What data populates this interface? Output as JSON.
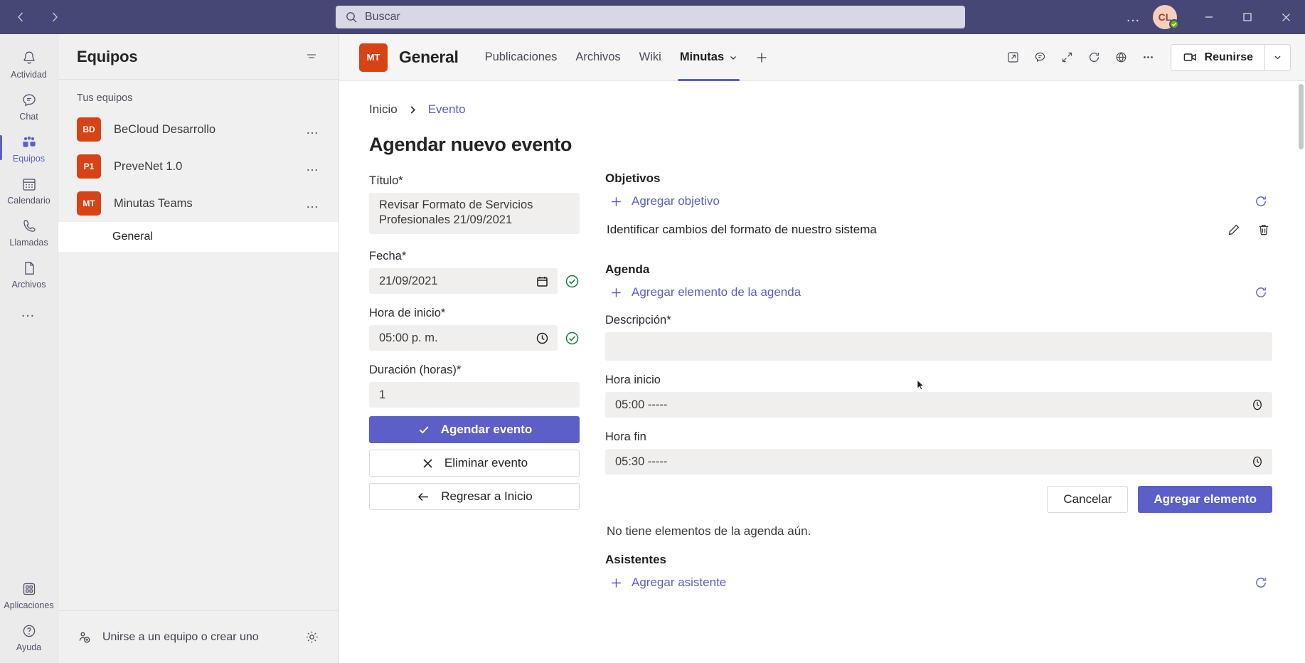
{
  "titlebar": {
    "back_label": "Atrás",
    "forward_label": "Adelante",
    "search_placeholder": "Buscar",
    "more_label": "…",
    "avatar_initials": "CL",
    "presence": "Disponible",
    "minimize_label": "Minimizar",
    "maximize_label": "Maximizar",
    "close_label": "Cerrar"
  },
  "rail": {
    "items": [
      {
        "label": "Actividad",
        "icon": "bell-icon",
        "active": false
      },
      {
        "label": "Chat",
        "icon": "chat-icon",
        "active": false
      },
      {
        "label": "Equipos",
        "icon": "teams-icon",
        "active": true
      },
      {
        "label": "Calendario",
        "icon": "calendar-icon",
        "active": false
      },
      {
        "label": "Llamadas",
        "icon": "phone-icon",
        "active": false
      },
      {
        "label": "Archivos",
        "icon": "file-icon",
        "active": false
      }
    ],
    "more_label": "…",
    "bottom": [
      {
        "label": "Aplicaciones",
        "icon": "apps-icon"
      },
      {
        "label": "Ayuda",
        "icon": "help-icon"
      }
    ]
  },
  "teams_panel": {
    "title": "Equipos",
    "filter_label": "Filtrar",
    "group_label": "Tus equipos",
    "teams": [
      {
        "initials": "BD",
        "name": "BeCloud Desarrollo",
        "more": "…"
      },
      {
        "initials": "P1",
        "name": "PreveNet 1.0",
        "more": "…"
      },
      {
        "initials": "MT",
        "name": "Minutas Teams",
        "more": "…"
      }
    ],
    "channels": [
      {
        "name": "General",
        "active": true
      }
    ],
    "footer": {
      "join_label": "Unirse a un equipo o crear uno",
      "settings_label": "Administrar equipos"
    }
  },
  "channel_header": {
    "avatar_initials": "MT",
    "title": "General",
    "tabs": [
      {
        "label": "Publicaciones",
        "active": false,
        "caret": false
      },
      {
        "label": "Archivos",
        "active": false,
        "caret": false
      },
      {
        "label": "Wiki",
        "active": false,
        "caret": false
      },
      {
        "label": "Minutas",
        "active": true,
        "caret": true
      }
    ],
    "add_tab_label": "+",
    "actions": [
      {
        "icon": "open-in-new-icon",
        "label": "Abrir en nueva ventana"
      },
      {
        "icon": "chat-bubble-icon",
        "label": "Conversación sobre la pestaña"
      },
      {
        "icon": "expand-icon",
        "label": "Expandir"
      },
      {
        "icon": "refresh-icon",
        "label": "Actualizar"
      },
      {
        "icon": "globe-icon",
        "label": "Ir al sitio web"
      },
      {
        "icon": "more-icon",
        "label": "Más opciones"
      }
    ],
    "meet_label": "Reunirse",
    "meet_caret_label": "Opciones de reunión"
  },
  "breadcrumb": [
    {
      "label": "Inicio",
      "link": false
    },
    {
      "label": "Evento",
      "link": true
    }
  ],
  "page": {
    "title": "Agendar nuevo evento"
  },
  "event_form": {
    "title_label": "Título*",
    "title_value": "Revisar Formato de Servicios Profesionales 21/09/2021",
    "date_label": "Fecha*",
    "date_value": "21/09/2021",
    "date_icon": "calendar-icon",
    "date_valid_icon": "check-circle-icon",
    "start_label": "Hora de inicio*",
    "start_value": "05:00 p. m.",
    "start_icon": "clock-icon",
    "start_valid_icon": "check-circle-icon",
    "duration_label": "Duración (horas)*",
    "duration_value": "1",
    "buttons": [
      {
        "label": "Agendar evento",
        "icon": "check-icon",
        "style": "primary"
      },
      {
        "label": "Eliminar evento",
        "icon": "close-icon",
        "style": "outline"
      },
      {
        "label": "Regresar a Inicio",
        "icon": "arrow-left-icon",
        "style": "outline"
      }
    ]
  },
  "objectives": {
    "section_title": "Objetivos",
    "add_label": "Agregar objetivo",
    "add_icon": "plus-icon",
    "refresh_icon": "refresh-icon",
    "items": [
      {
        "text": "Identificar cambios del formato de nuestro sistema",
        "edit_icon": "pencil-icon",
        "delete_icon": "trash-icon"
      }
    ]
  },
  "agenda": {
    "section_title": "Agenda",
    "add_label": "Agregar elemento de la agenda",
    "add_icon": "plus-icon",
    "refresh_icon": "refresh-icon",
    "description_label": "Descripción*",
    "description_value": "",
    "start_label": "Hora inicio",
    "start_value": "05:00 -----",
    "start_icon": "clock-icon",
    "end_label": "Hora fin",
    "end_value": "05:30 -----",
    "end_icon": "clock-icon",
    "cancel_label": "Cancelar",
    "submit_label": "Agregar elemento",
    "empty_message": "No tiene elementos de la agenda aún."
  },
  "attendees": {
    "section_title": "Asistentes",
    "add_label": "Agregar asistente",
    "add_icon": "plus-icon",
    "refresh_icon": "refresh-icon"
  },
  "colors": {
    "titlebar": "#464775",
    "accent": "#5b5fc7",
    "team_avatar": "#d74315",
    "success": "#107c41",
    "presence": "#6bb700",
    "input_bg": "#f0efee"
  }
}
